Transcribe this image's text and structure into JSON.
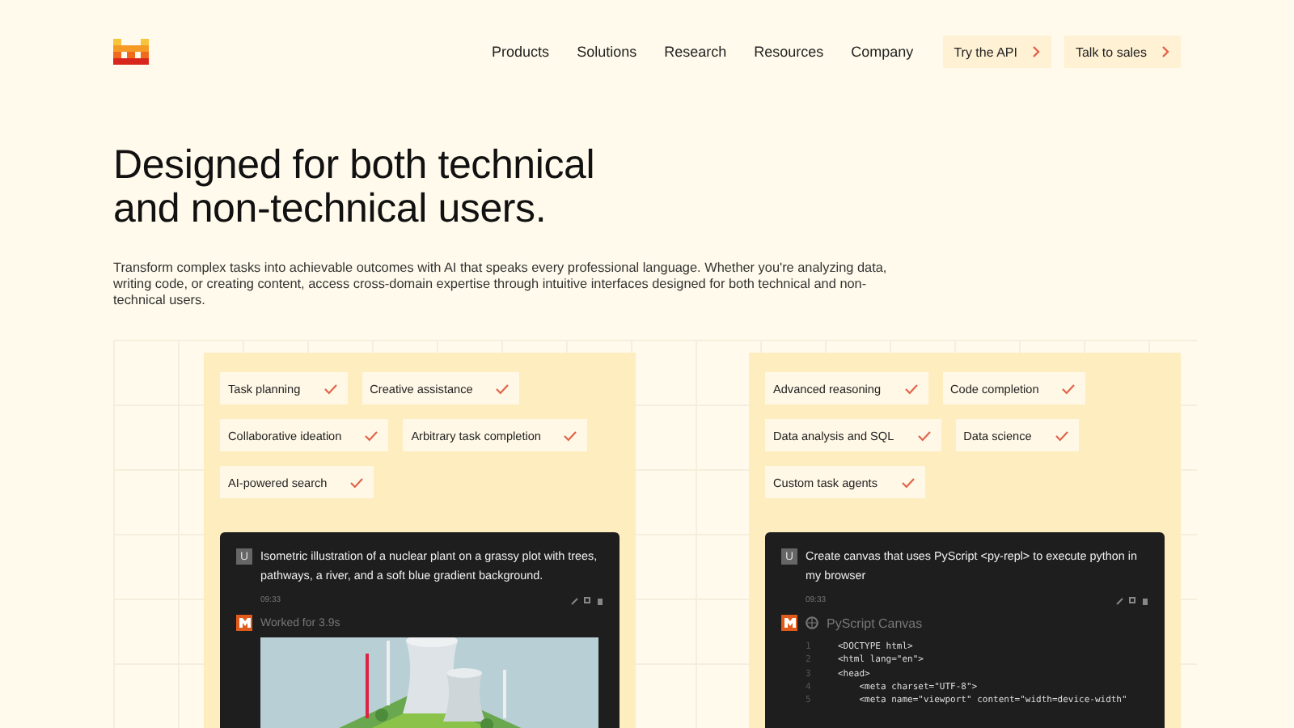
{
  "nav": {
    "links": [
      "Products",
      "Solutions",
      "Research",
      "Resources",
      "Company"
    ],
    "buttons": [
      "Try the API",
      "Talk to sales"
    ]
  },
  "hero": {
    "title_lines": [
      "Designed for both technical",
      "and non-technical users."
    ],
    "description": "Transform complex tasks into achievable outcomes with AI that speaks every professional language. Whether you're analyzing data, writing code, or creating content, access cross-domain expertise through intuitive interfaces designed for both technical and non-technical users."
  },
  "panels": [
    {
      "features": [
        {
          "label": "Task planning",
          "checked": true
        },
        {
          "label": "Creative assistance",
          "checked": true
        },
        {
          "label": "Collaborative ideation",
          "checked": true
        },
        {
          "label": "Arbitrary task completion",
          "checked": true
        },
        {
          "label": "AI-powered search",
          "checked": true
        }
      ],
      "chat": {
        "avatar": "U",
        "prompt": "Isometric illustration of a nuclear plant on a grassy plot with trees, pathways, a river, and a soft blue gradient background.",
        "time": "09:33",
        "reply": {
          "status": "Worked for 3.9s"
        }
      }
    },
    {
      "features": [
        {
          "label": "Advanced reasoning",
          "checked": true
        },
        {
          "label": "Code completion",
          "checked": true
        },
        {
          "label": "Data analysis and SQL",
          "checked": true
        },
        {
          "label": "Data science",
          "checked": true
        },
        {
          "label": "Custom task agents",
          "checked": true
        }
      ],
      "chat": {
        "avatar": "U",
        "prompt": "Create canvas that uses PyScript <py-repl> to execute python in my browser",
        "time": "09:33",
        "reply": {
          "kind": "code",
          "title": "PyScript Canvas",
          "lines": [
            {
              "number": "1",
              "code": "<DOCTYPE html>"
            },
            {
              "number": "2",
              "code": "<html lang=\"en\">"
            },
            {
              "number": "3",
              "code": "<head>"
            },
            {
              "number": "4",
              "code": "    <meta charset=\"UTF-8\">"
            },
            {
              "number": "5",
              "code": "    <meta name=\"viewport\" content=\"width=device-width\""
            }
          ]
        }
      }
    }
  ]
}
